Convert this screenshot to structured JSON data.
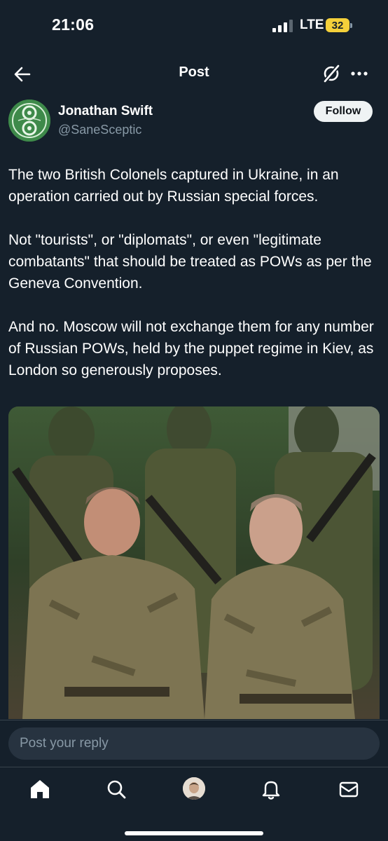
{
  "status_bar": {
    "time": "21:06",
    "network": "LTE",
    "battery": "32"
  },
  "header": {
    "title": "Post",
    "back_icon": "arrow-left-icon",
    "grok_icon": "slashed-circle-icon",
    "more_icon": "more-horizontal-icon"
  },
  "author": {
    "name": "Jonathan Swift",
    "handle": "@SaneSceptic",
    "follow_label": "Follow"
  },
  "tweet": {
    "paragraphs": [
      "The two British Colonels captured in Ukraine, in an operation carried out by Russian special forces.",
      "Not \"tourists\", or \"diplomats\", or even \"legitimate combatants\" that should be treated as POWs as per the Geneva Convention.",
      "And no. Moscow will not exchange them for any number of Russian POWs, held by the puppet regime in Kiev, as London so generously proposes."
    ]
  },
  "reply": {
    "placeholder": "Post your reply"
  },
  "nav": {
    "items": [
      "home-icon",
      "search-icon",
      "profile-avatar",
      "bell-icon",
      "mail-icon"
    ]
  },
  "colors": {
    "background": "#15202b",
    "text_secondary": "#8899a6",
    "battery": "#f4d03a"
  }
}
